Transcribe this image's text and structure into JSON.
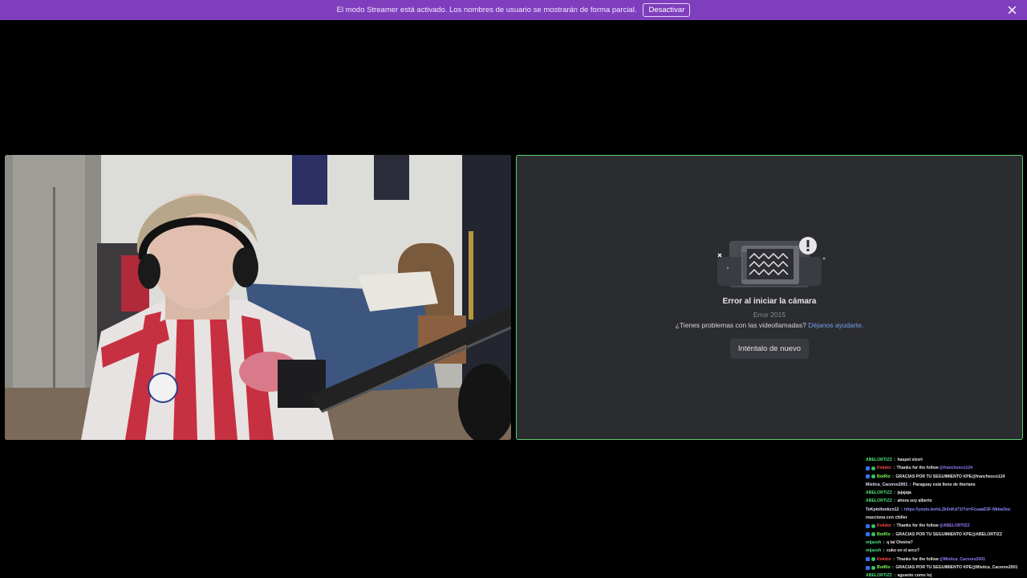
{
  "banner": {
    "message": "El modo Streamer está activado. Los nombres de usuario se mostrarán de forma parcial.",
    "button_label": "Desactivar",
    "accent": "#7f3fbd"
  },
  "error_tile": {
    "title": "Error al iniciar la cámara",
    "code": "Error 2015",
    "help_text": "¿Tienes problemas con las videollamadas? ",
    "help_link": "Déjanos ayudarte.",
    "retry_label": "Inténtalo de nuevo",
    "border_color": "#5ad06b"
  },
  "chat": {
    "lines": [
      {
        "user": "ABELORTIZZ",
        "user_color": "green",
        "badge": false,
        "parts": [
          {
            "t": "haspel elzert"
          }
        ]
      },
      {
        "user": "Kekdor",
        "user_color": "red",
        "badge": true,
        "parts": [
          {
            "t": "Thanks for the follow "
          },
          {
            "t": "@franchesco124",
            "c": "mention"
          }
        ]
      },
      {
        "user": "BotRix",
        "user_color": "lime",
        "badge": true,
        "parts": [
          {
            "t": "GRACIAS POR TU SEGUIMIENTO KPE@franchesco124"
          }
        ]
      },
      {
        "user": "Mistica_Caceres2001",
        "user_color": "white",
        "badge": false,
        "parts": [
          {
            "t": "Paraguay está lleno de therians"
          }
        ]
      },
      {
        "user": "ABELORTIZZ",
        "user_color": "green",
        "badge": false,
        "parts": [
          {
            "t": "jajajaja"
          }
        ]
      },
      {
        "user": "ABELORTIZZ",
        "user_color": "green",
        "badge": false,
        "parts": [
          {
            "t": "ahora soy alberto"
          }
        ]
      },
      {
        "user": "TeKpioltonkco12",
        "user_color": "white",
        "badge": false,
        "parts": [
          {
            "t": "https://youtu.be/nLZk5nKd71l?si=FcuaaD3F-Nkbw3oc",
            "c": "link"
          }
        ]
      },
      {
        "user": "",
        "user_color": "white",
        "badge": false,
        "parts": [
          {
            "t": "reacciona con chiller"
          }
        ]
      },
      {
        "user": "Kekdor",
        "user_color": "red",
        "badge": true,
        "parts": [
          {
            "t": "Thanks for the follow "
          },
          {
            "t": "@ABELORTIZZ",
            "c": "mention"
          }
        ]
      },
      {
        "user": "BotRix",
        "user_color": "lime",
        "badge": true,
        "parts": [
          {
            "t": "GRACIAS POR TU SEGUIMIENTO KPE@ABELORTIZZ"
          }
        ]
      },
      {
        "user": "mijazoh",
        "user_color": "green",
        "badge": false,
        "parts": [
          {
            "t": "q tal Olveira?"
          }
        ]
      },
      {
        "user": "mijazoh",
        "user_color": "green",
        "badge": false,
        "parts": [
          {
            "t": "cuko en el arco?"
          }
        ]
      },
      {
        "user": "Kekdor",
        "user_color": "red",
        "badge": true,
        "parts": [
          {
            "t": "Thanks for the follow "
          },
          {
            "t": "@Mistica_Caceres2001",
            "c": "mention"
          }
        ]
      },
      {
        "user": "BotRix",
        "user_color": "lime",
        "badge": true,
        "parts": [
          {
            "t": "GRACIAS POR TU SEGUIMIENTO KPE@Mistica_Caceres2001"
          }
        ]
      },
      {
        "user": "ABELORTIZZ",
        "user_color": "green",
        "badge": false,
        "parts": [
          {
            "t": "aguante como loj"
          }
        ]
      }
    ]
  }
}
